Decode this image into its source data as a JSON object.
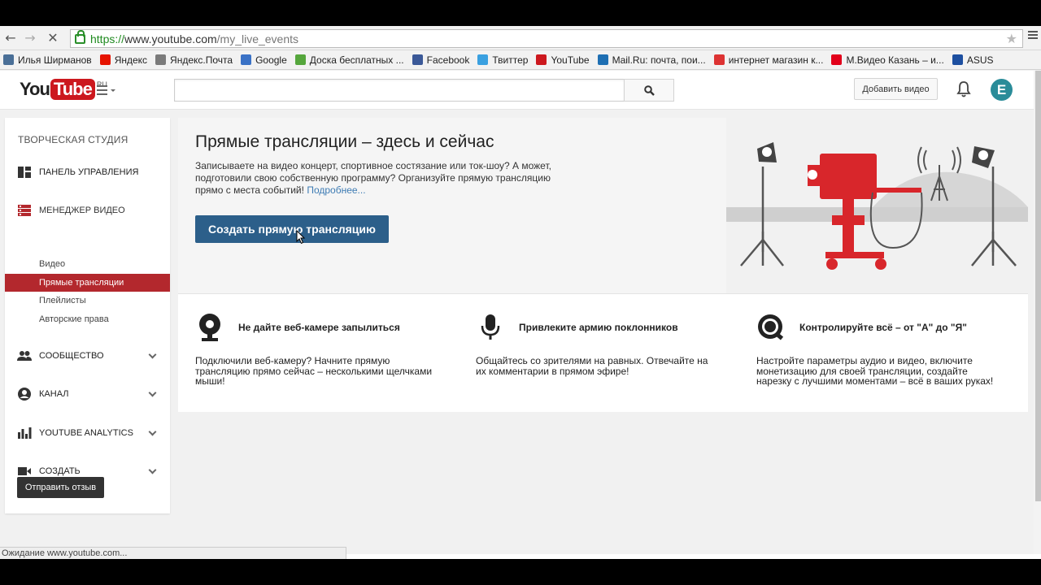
{
  "browser": {
    "url_scheme": "https://",
    "url_host": "www.youtube.com",
    "url_path": "/my_live_events",
    "bookmarks": [
      {
        "label": "Илья Ширманов",
        "icon": "vk-icon",
        "color": "#4a6f97"
      },
      {
        "label": "Яндекс",
        "icon": "yandex-icon",
        "color": "#e61400"
      },
      {
        "label": "Яндекс.Почта",
        "icon": "mail-icon",
        "color": "#7a7a7a"
      },
      {
        "label": "Google",
        "icon": "google-icon",
        "color": "#3a72c6"
      },
      {
        "label": "Доска бесплатных ...",
        "icon": "board-icon",
        "color": "#55a63c"
      },
      {
        "label": "Facebook",
        "icon": "facebook-icon",
        "color": "#3b5998"
      },
      {
        "label": "Твиттер",
        "icon": "twitter-icon",
        "color": "#3aa0e0"
      },
      {
        "label": "YouTube",
        "icon": "youtube-icon",
        "color": "#cc181e"
      },
      {
        "label": "Mail.Ru: почта, пои...",
        "icon": "mailru-icon",
        "color": "#1e6fb3"
      },
      {
        "label": "интернет магазин к...",
        "icon": "shop-icon",
        "color": "#d33"
      },
      {
        "label": "М.Видео Казань – и...",
        "icon": "mvideo-icon",
        "color": "#e2001a"
      },
      {
        "label": "ASUS",
        "icon": "asus-icon",
        "color": "#1d4fa0"
      }
    ],
    "status_text": "Ожидание www.youtube.com..."
  },
  "header": {
    "logo_you": "You",
    "logo_tube": "Tube",
    "logo_region": "RU",
    "upload_label": "Добавить видео",
    "avatar_letter": "E",
    "avatar_color": "#2a8c99"
  },
  "sidebar": {
    "title": "ТВОРЧЕСКАЯ СТУДИЯ",
    "dashboard": "ПАНЕЛЬ УПРАВЛЕНИЯ",
    "video_manager": "МЕНЕДЖЕР ВИДЕО",
    "sub_items": [
      "Видео",
      "Прямые трансляции",
      "Плейлисты",
      "Авторские права"
    ],
    "community": "СООБЩЕСТВО",
    "channel": "КАНАЛ",
    "analytics": "YOUTUBE ANALYTICS",
    "create": "СОЗДАТЬ",
    "feedback": "Отправить отзыв"
  },
  "hero": {
    "title": "Прямые трансляции – здесь и сейчас",
    "description": "Записываете на видео концерт, спортивное состязание или ток-шоу? А может, подготовили свою собственную программу? Организуйте прямую трансляцию прямо с места событий!",
    "more_link": "Подробнее...",
    "create_button": "Создать прямую трансляцию",
    "accent_color": "#2c5f8a"
  },
  "features": [
    {
      "icon": "webcam-icon",
      "title": "Не дайте веб-камере запылиться",
      "text": "Подключили веб-камеру? Начните прямую трансляцию прямо сейчас – несколькими щелчками мыши!"
    },
    {
      "icon": "microphone-icon",
      "title": "Привлеките армию поклонников",
      "text": "Общайтесь со зрителями на равных. Отвечайте на их комментарии в прямом эфире!"
    },
    {
      "icon": "search-control-icon",
      "title": "Контролируйте всё – от \"А\" до \"Я\"",
      "text": "Настройте параметры аудио и видео, включите монетизацию для своей трансляции, создайте нарезку с лучшими моментами – всё в ваших руках!"
    }
  ]
}
